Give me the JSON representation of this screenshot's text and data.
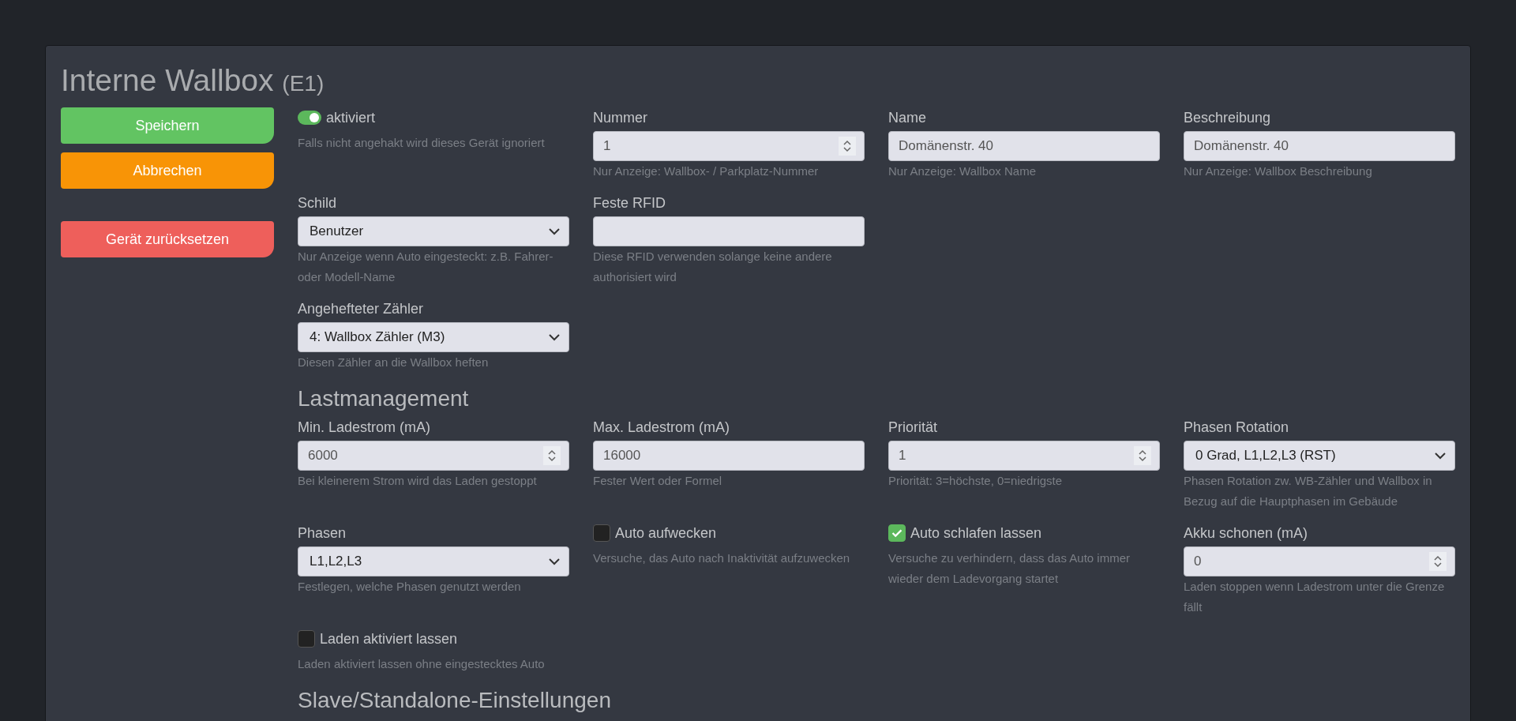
{
  "title": {
    "text": "Interne Wallbox",
    "suffix": "(E1)"
  },
  "buttons": [
    {
      "label": "Speichern",
      "kind": "save"
    },
    {
      "label": "Abbrechen",
      "kind": "cancel"
    },
    {
      "label": "Gerät zurücksetzen",
      "kind": "reset"
    }
  ],
  "sections": [
    {
      "rows": [
        [
          {
            "kind": "switch",
            "label": "aktiviert",
            "on": true,
            "help": "Falls nicht angehakt wird dieses Gerät ignoriert"
          },
          {
            "kind": "number",
            "label": "Nummer",
            "value": "1",
            "help": "Nur Anzeige: Wallbox- / Parkplatz-Nummer"
          },
          {
            "kind": "text",
            "label": "Name",
            "value": "Domänenstr. 40",
            "help": "Nur Anzeige: Wallbox Name"
          },
          {
            "kind": "text",
            "label": "Beschreibung",
            "value": "Domänenstr. 40",
            "help": "Nur Anzeige: Wallbox Beschreibung"
          }
        ],
        [
          {
            "kind": "select",
            "label": "Schild",
            "value": "Benutzer",
            "help": "Nur Anzeige wenn Auto eingesteckt: z.B. Fahrer- oder Modell-Name"
          },
          {
            "kind": "text",
            "label": "Feste RFID",
            "help": "Diese RFID verwenden solange keine andere authorisiert wird"
          }
        ],
        [
          {
            "kind": "select",
            "label": "Angehefteter Zähler",
            "value": "4: Wallbox Zähler (M3)",
            "help": "Diesen Zähler an die Wallbox heften"
          }
        ]
      ]
    },
    {
      "heading": "Lastmanagement",
      "rows": [
        [
          {
            "kind": "number",
            "label": "Min. Ladestrom (mA)",
            "value": "6000",
            "help": "Bei kleinerem Strom wird das Laden gestoppt"
          },
          {
            "kind": "text",
            "label": "Max. Ladestrom (mA)",
            "value": "16000",
            "help": "Fester Wert oder Formel"
          },
          {
            "kind": "number",
            "label": "Priorität",
            "value": "1",
            "help": "Priorität: 3=höchste, 0=niedrigste"
          },
          {
            "kind": "select",
            "label": "Phasen Rotation",
            "value": "0 Grad, L1,L2,L3 (RST)",
            "help": "Phasen Rotation zw. WB-Zähler und Wallbox in Bezug auf die Hauptphasen im Gebäude"
          }
        ],
        [
          {
            "kind": "select",
            "label": "Phasen",
            "value": "L1,L2,L3",
            "help": "Festlegen, welche Phasen genutzt werden"
          },
          {
            "kind": "checkbox",
            "label": "Auto aufwecken",
            "checked": false,
            "help": "Versuche, das Auto nach Inaktivität aufzuwecken"
          },
          {
            "kind": "checkbox",
            "label": "Auto schlafen lassen",
            "checked": true,
            "help": "Versuche zu verhindern, dass das Auto immer wieder dem Ladevorgang startet"
          },
          {
            "kind": "number",
            "label": "Akku schonen (mA)",
            "value": "0",
            "help": "Laden stoppen wenn Ladestrom unter die Grenze fällt"
          }
        ],
        [
          {
            "kind": "checkbox",
            "label": "Laden aktiviert lassen",
            "checked": false,
            "help": "Laden aktiviert lassen ohne eingestecktes Auto"
          }
        ]
      ]
    },
    {
      "heading": "Slave/Standalone-Einstellungen"
    }
  ]
}
